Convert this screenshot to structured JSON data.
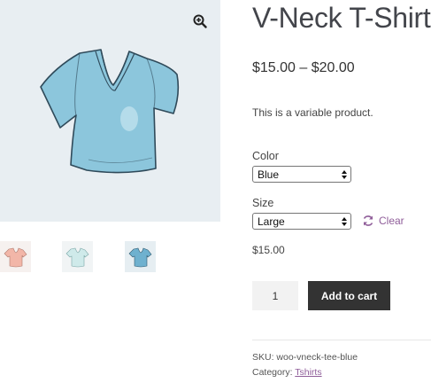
{
  "gallery": {
    "zoom_icon": "magnifier-plus-icon",
    "main_image": "blue-v-neck-tshirt",
    "thumbnails": [
      {
        "name": "pink-tshirt",
        "color": "#f2b6a8"
      },
      {
        "name": "mint-tshirt",
        "color": "#cfeaea"
      },
      {
        "name": "blue-tshirt",
        "color": "#6fb1cf"
      }
    ]
  },
  "product": {
    "title": "V-Neck T-Shirt",
    "price_range": "$15.00 – $20.00",
    "description": "This is a variable product.",
    "color_label": "Color",
    "color_value": "Blue",
    "size_label": "Size",
    "size_value": "Large",
    "clear_label": "Clear",
    "variation_price": "$15.00",
    "quantity": "1",
    "add_to_cart_label": "Add to cart",
    "sku_text": "SKU: woo-vneck-tee-blue",
    "category_prefix": "Category: ",
    "category_link": "Tshirts"
  },
  "colors": {
    "accent": "#8f5d99",
    "button_bg": "#333333",
    "image_bg": "#e8eef2"
  }
}
